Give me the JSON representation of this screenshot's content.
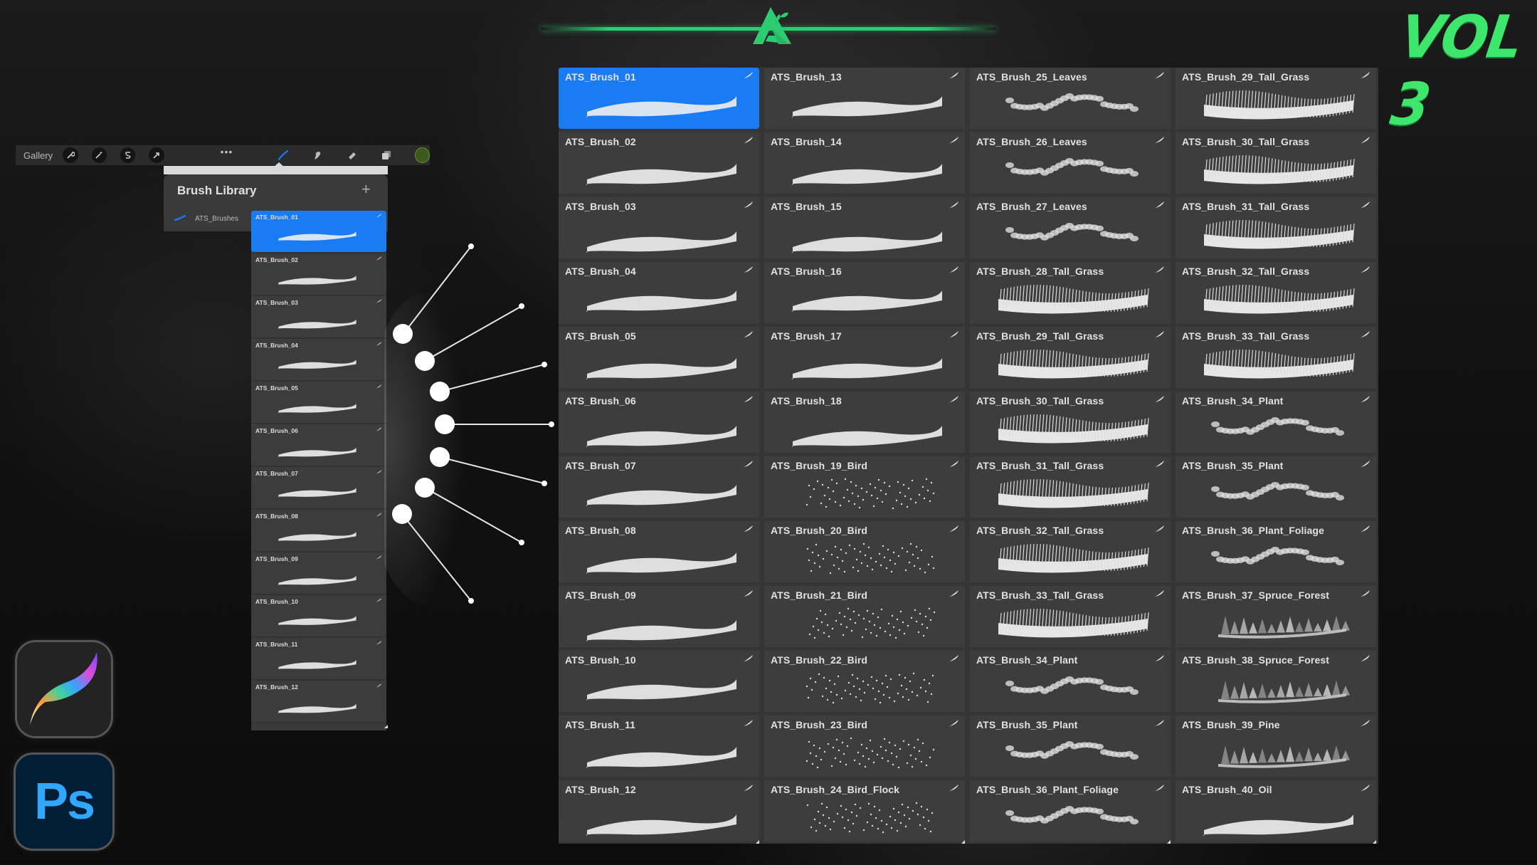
{
  "header": {
    "logo_icon": "ats-triangle-leaf-logo",
    "volume_badge": "VOL 3",
    "accent_color": "#2ecc71",
    "badge_color": "#3ee66b"
  },
  "toolbar": {
    "gallery_label": "Gallery",
    "left_icons": [
      "wrench-icon",
      "magic-wand-icon",
      "selection-s-icon",
      "arrow-cursor-icon"
    ],
    "more_label": "•••",
    "right_icons": [
      "brush-icon",
      "smudge-icon",
      "eraser-icon",
      "layers-icon"
    ],
    "current_color": "#3c5a1e"
  },
  "brush_library": {
    "title": "Brush Library",
    "add_label": "+",
    "set_name": "ATS_Brushes",
    "selected_color": "#1a7cf5",
    "mini_list": [
      "ATS_Brush_01",
      "ATS_Brush_02",
      "ATS_Brush_03",
      "ATS_Brush_04",
      "ATS_Brush_05",
      "ATS_Brush_06",
      "ATS_Brush_07",
      "ATS_Brush_08",
      "ATS_Brush_09",
      "ATS_Brush_10",
      "ATS_Brush_11",
      "ATS_Brush_12"
    ],
    "selected_index": 0
  },
  "brush_grid": {
    "columns": [
      [
        "ATS_Brush_01",
        "ATS_Brush_02",
        "ATS_Brush_03",
        "ATS_Brush_04",
        "ATS_Brush_05",
        "ATS_Brush_06",
        "ATS_Brush_07",
        "ATS_Brush_08",
        "ATS_Brush_09",
        "ATS_Brush_10",
        "ATS_Brush_11",
        "ATS_Brush_12"
      ],
      [
        "ATS_Brush_13",
        "ATS_Brush_14",
        "ATS_Brush_15",
        "ATS_Brush_16",
        "ATS_Brush_17",
        "ATS_Brush_18",
        "ATS_Brush_19_Bird",
        "ATS_Brush_20_Bird",
        "ATS_Brush_21_Bird",
        "ATS_Brush_22_Bird",
        "ATS_Brush_23_Bird",
        "ATS_Brush_24_Bird_Flock"
      ],
      [
        "ATS_Brush_25_Leaves",
        "ATS_Brush_26_Leaves",
        "ATS_Brush_27_Leaves",
        "ATS_Brush_28_Tall_Grass",
        "ATS_Brush_29_Tall_Grass",
        "ATS_Brush_30_Tall_Grass",
        "ATS_Brush_31_Tall_Grass",
        "ATS_Brush_32_Tall_Grass",
        "ATS_Brush_33_Tall_Grass",
        "ATS_Brush_34_Plant",
        "ATS_Brush_35_Plant",
        "ATS_Brush_36_Plant_Foliage"
      ],
      [
        "ATS_Brush_29_Tall_Grass",
        "ATS_Brush_30_Tall_Grass",
        "ATS_Brush_31_Tall_Grass",
        "ATS_Brush_32_Tall_Grass",
        "ATS_Brush_33_Tall_Grass",
        "ATS_Brush_34_Plant",
        "ATS_Brush_35_Plant",
        "ATS_Brush_36_Plant_Foliage",
        "ATS_Brush_37_Spruce_Forest",
        "ATS_Brush_38_Spruce_Forest",
        "ATS_Brush_39_Pine",
        "ATS_Brush_40_Oil"
      ]
    ],
    "selected": {
      "column": 0,
      "row": 0
    }
  },
  "apps": {
    "procreate_icon": "procreate-feather-icon",
    "photoshop_label": "Ps",
    "photoshop_color": "#31a8ff"
  }
}
